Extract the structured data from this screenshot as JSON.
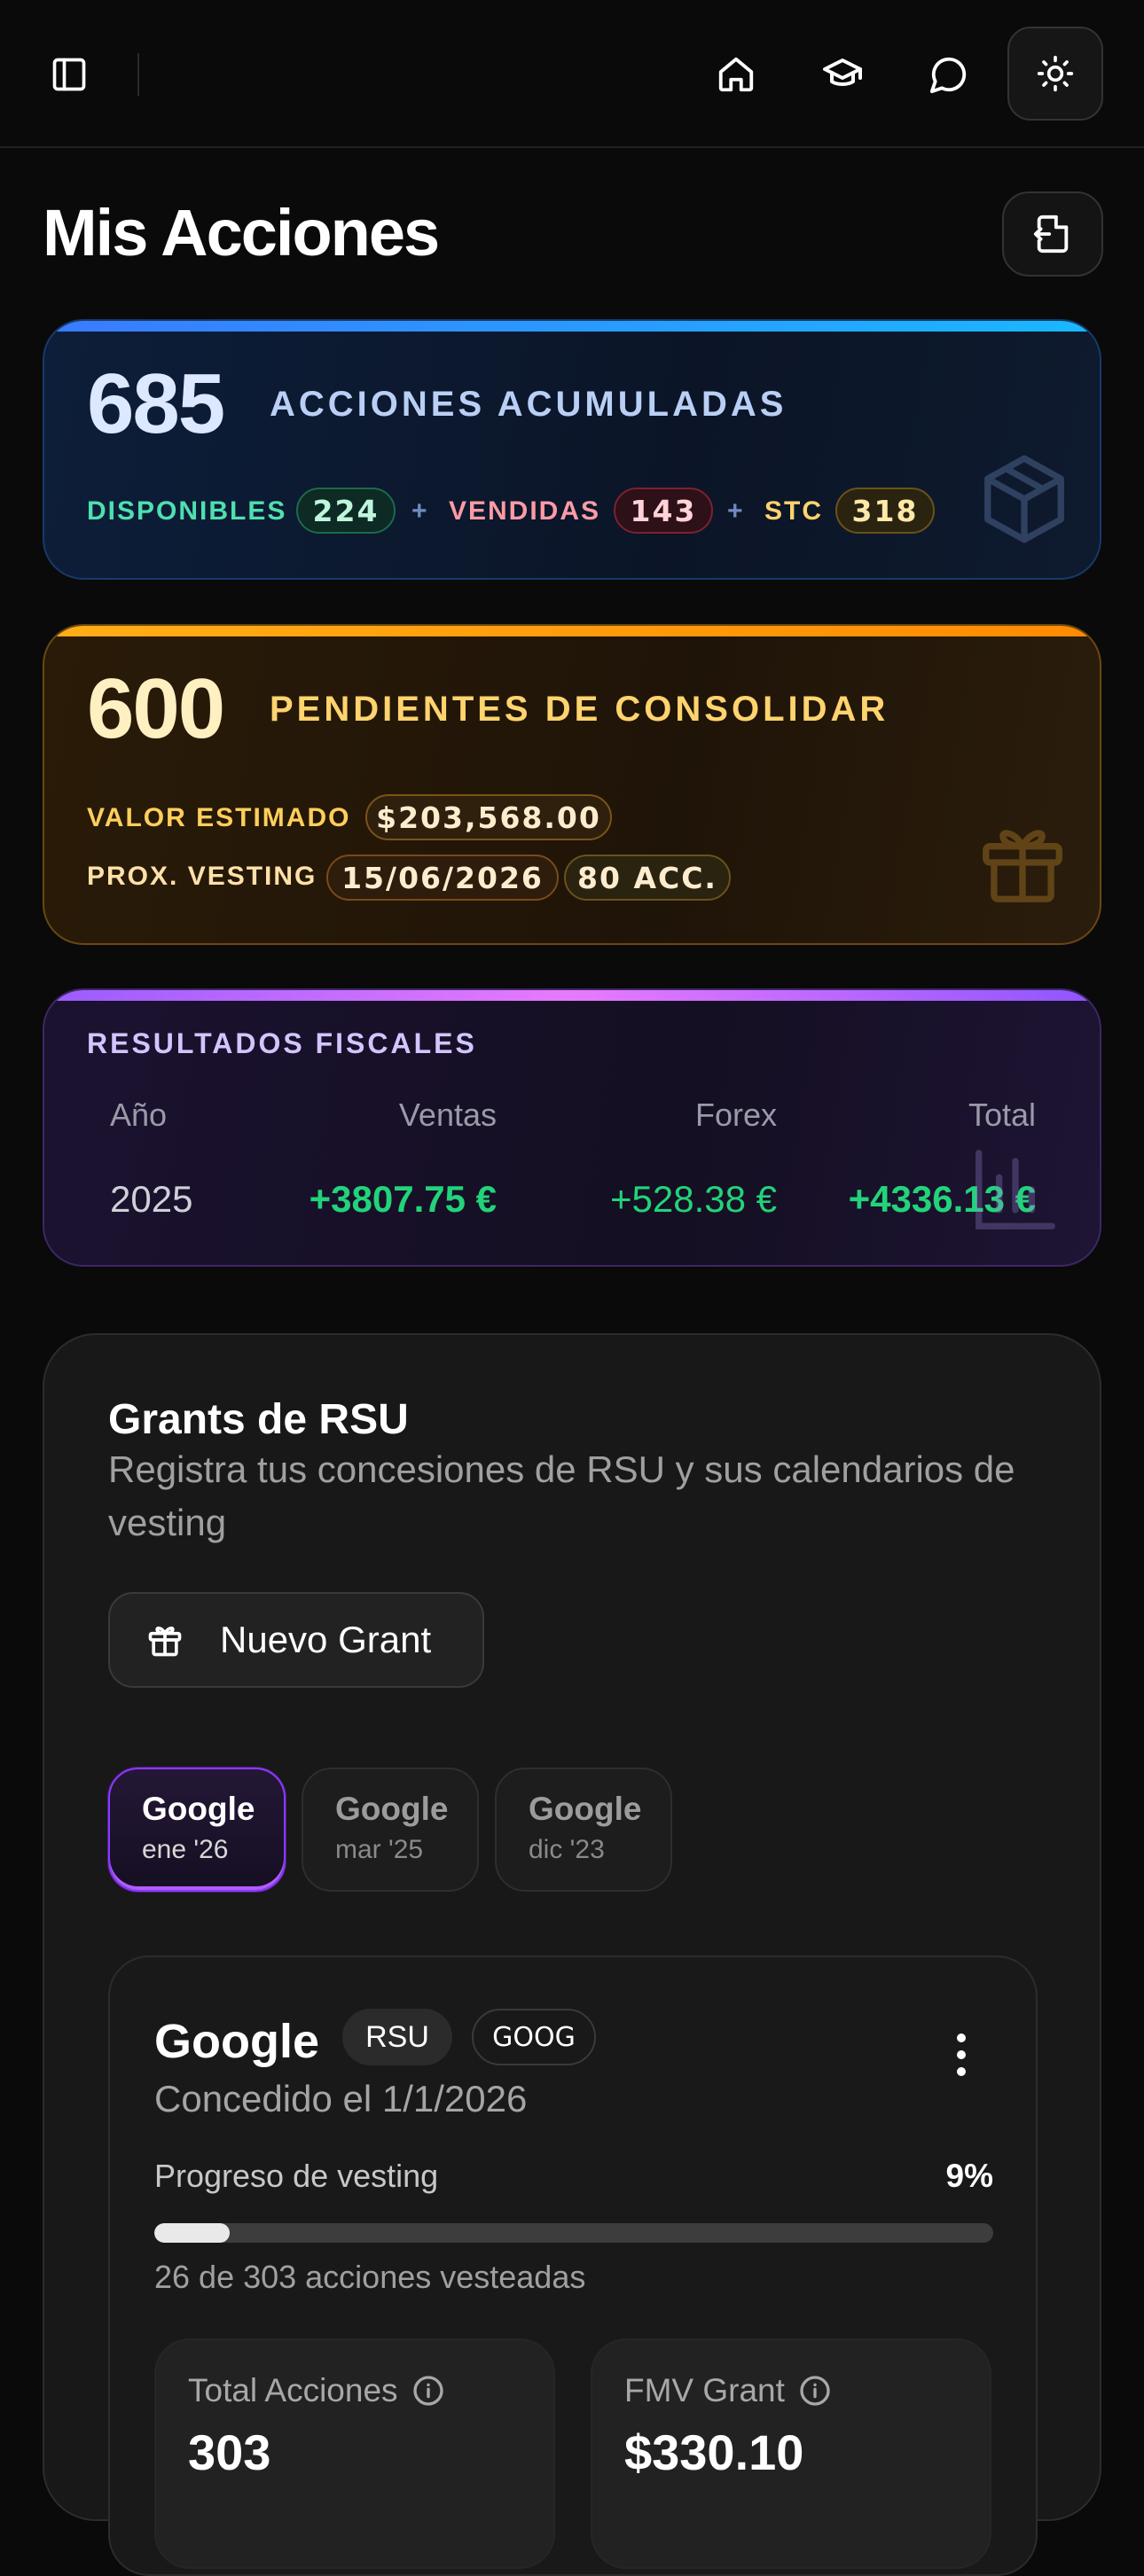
{
  "page": {
    "title": "Mis Acciones"
  },
  "colors": {
    "accent_blue": "#3a7bff",
    "accent_amber": "#ffae16",
    "accent_purple": "#b45cff",
    "positive_green": "#22d37a"
  },
  "accumulated": {
    "count": "685",
    "label": "ACCIONES ACUMULADAS",
    "available_label": "DISPONIBLES",
    "available_value": "224",
    "plus1": "+",
    "sold_label": "VENDIDAS",
    "sold_value": "143",
    "plus2": "+",
    "stc_label": "STC",
    "stc_value": "318",
    "icon": "box-icon"
  },
  "pending": {
    "count": "600",
    "label": "PENDIENTES DE CONSOLIDAR",
    "est_label": "VALOR ESTIMADO",
    "est_value": "$203,568.00",
    "next_label": "PROX. VESTING",
    "next_date": "15/06/2026",
    "next_shares": "80 ACC.",
    "icon": "gift-icon"
  },
  "fiscal": {
    "title": "RESULTADOS FISCALES",
    "headers": [
      "Año",
      "Ventas",
      "Forex",
      "Total"
    ],
    "row": [
      "2025",
      "+3807.75 €",
      "+528.38 €",
      "+4336.13 €"
    ],
    "icon": "bar-chart-icon"
  },
  "grants": {
    "title": "Grants de RSU",
    "subtitle": "Registra tus concesiones de RSU y sus calendarios de vesting",
    "new_button": "Nuevo Grant",
    "tabs": [
      {
        "name": "Google",
        "date": "ene '26"
      },
      {
        "name": "Google",
        "date": "mar '25"
      },
      {
        "name": "Google",
        "date": "dic '23"
      }
    ],
    "detail": {
      "title": "Google",
      "badge_type": "RSU",
      "badge_ticker": "GOOG",
      "granted": "Concedido el 1/1/2026",
      "progress_label": "Progreso de vesting",
      "progress_pct": "9%",
      "progress_fraction": 0.09,
      "progress_sub": "26 de 303 acciones vesteadas",
      "stats": [
        {
          "label": "Total Acciones",
          "value": "303"
        },
        {
          "label": "FMV Grant",
          "value": "$330.10"
        }
      ]
    }
  }
}
